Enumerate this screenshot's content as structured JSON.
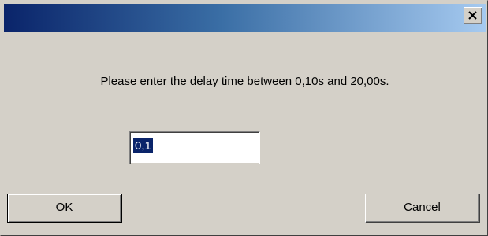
{
  "titlebar": {
    "title": "",
    "close_icon": "close-icon"
  },
  "message": "Please enter the delay time between 0,10s and 20,00s.",
  "input": {
    "value": "0,1"
  },
  "buttons": {
    "ok_label": "OK",
    "cancel_label": "Cancel"
  },
  "colors": {
    "titlebar_start": "#0a246a",
    "titlebar_end": "#a6caf0",
    "dialog_bg": "#d4d0c8",
    "selection_bg": "#0a246a"
  }
}
